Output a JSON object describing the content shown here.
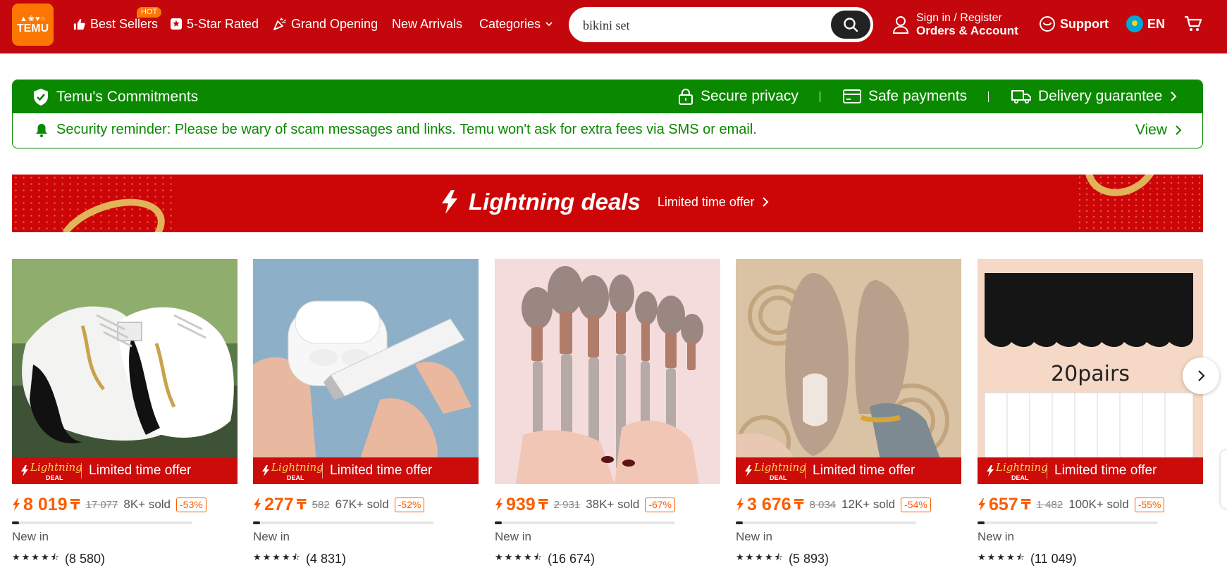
{
  "header": {
    "logo_top": "▲❀♥○",
    "logo_text": "TEMU",
    "nav": [
      {
        "label": "Best Sellers",
        "icon": "thumbs-up-icon"
      },
      {
        "label": "5-Star Rated",
        "icon": "star-box-icon"
      },
      {
        "label": "Grand Opening",
        "icon": "party-popper-icon"
      },
      {
        "label": "New Arrivals"
      },
      {
        "label": "Categories",
        "icon": "chevron-down-icon"
      }
    ],
    "hot_badge": "HOT",
    "search": {
      "value": "bikini set",
      "placeholder": "bikini set"
    },
    "account": {
      "line1": "Sign in / Register",
      "line2": "Orders & Account"
    },
    "support": "Support",
    "language": "EN",
    "brand_color": "#c3070d",
    "accent_color": "#fb7701"
  },
  "commitments": {
    "title": "Temu's Commitments",
    "items": [
      "Secure privacy",
      "Safe payments",
      "Delivery guarantee"
    ],
    "reminder": "Security reminder: Please be wary of scam messages and links. Temu won't ask for extra fees via SMS or email.",
    "view": "View",
    "color": "#0a8800"
  },
  "banner": {
    "title": "Lightning deals",
    "subtitle": "Limited time offer"
  },
  "products": [
    {
      "name": "White sneakers",
      "price": "8 019",
      "currency": "₸",
      "original": "17 077",
      "sold": "8K+ sold",
      "discount": "-53%",
      "progress": 0.04,
      "status": "New in",
      "stars": "★★★★⯪",
      "reviews": "(8 580)",
      "deal_label": "Limited time offer",
      "deal_logo_1": "Lightning",
      "deal_logo_2": "DEAL"
    },
    {
      "name": "Earbud cleaning pen",
      "price": "277",
      "currency": "₸",
      "original": "582",
      "sold": "67K+ sold",
      "discount": "-52%",
      "progress": 0.04,
      "status": "New in",
      "stars": "★★★★⯪",
      "reviews": "(4 831)",
      "deal_label": "Limited time offer",
      "deal_logo_1": "Lightning",
      "deal_logo_2": "DEAL"
    },
    {
      "name": "Makeup brush set",
      "price": "939",
      "currency": "₸",
      "original": "2 931",
      "sold": "38K+ sold",
      "discount": "-67%",
      "progress": 0.04,
      "status": "New in",
      "stars": "★★★★⯪",
      "reviews": "(16 674)",
      "deal_label": "Limited time offer",
      "deal_logo_1": "Lightning",
      "deal_logo_2": "DEAL"
    },
    {
      "name": "Knit flats",
      "price": "3 676",
      "currency": "₸",
      "original": "8 034",
      "sold": "12K+ sold",
      "discount": "-54%",
      "progress": 0.04,
      "status": "New in",
      "stars": "★★★★⯪",
      "reviews": "(5 893)",
      "deal_label": "Limited time offer",
      "deal_logo_1": "Lightning",
      "deal_logo_2": "DEAL"
    },
    {
      "name": "Socks 20 pairs",
      "price": "657",
      "currency": "₸",
      "original": "1 482",
      "sold": "100K+ sold",
      "discount": "-55%",
      "progress": 0.04,
      "status": "New in",
      "stars": "★★★★⯪",
      "reviews": "(11 049)",
      "deal_label": "Limited time offer",
      "deal_logo_1": "Lightning",
      "deal_logo_2": "DEAL",
      "image_text": "20pairs"
    }
  ]
}
